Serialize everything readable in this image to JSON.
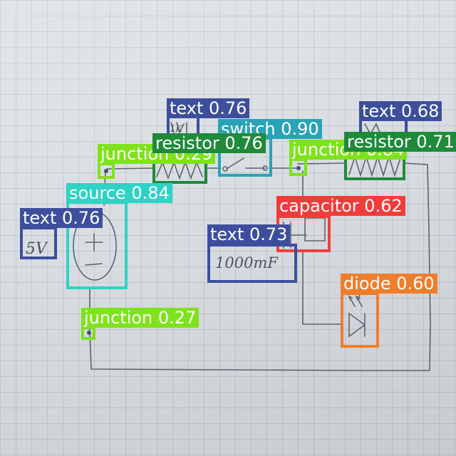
{
  "handwriting": {
    "voltage": "5V",
    "capacitance": "1000mF",
    "resistor_left_value": "1K"
  },
  "colors": {
    "text": "#3d4f9c",
    "resistor": "#1f8b3a",
    "switch": "#2aa3b7",
    "junction": "#7ee21d",
    "source": "#2fd3c4",
    "capacitor": "#f23c3c",
    "diode": "#f07d2a"
  },
  "detections": [
    {
      "label": "text 0.76"
    },
    {
      "label": "text 0.68"
    },
    {
      "label": "switch 0.90"
    },
    {
      "label": "resistor 0.76"
    },
    {
      "label": "resistor 0.71"
    },
    {
      "label": "junction 0.29"
    },
    {
      "label": "junction 0.84"
    },
    {
      "label": "source 0.84"
    },
    {
      "label": "text 0.76"
    },
    {
      "label": "capacitor 0.62"
    },
    {
      "label": "text 0.73"
    },
    {
      "label": "diode 0.60"
    },
    {
      "label": "junction 0.27"
    }
  ]
}
